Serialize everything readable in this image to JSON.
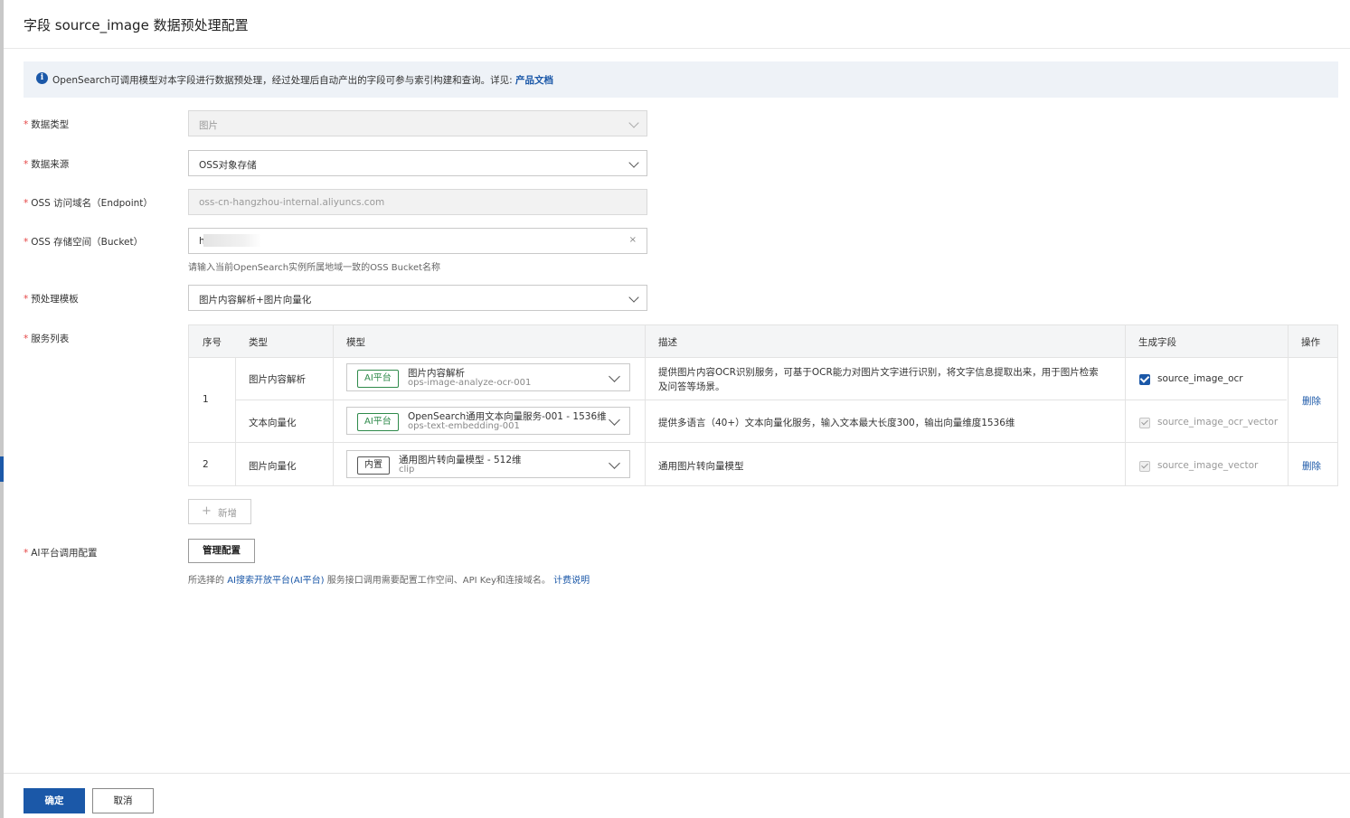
{
  "dialog": {
    "title": "字段 source_image 数据预处理配置",
    "info_text": "OpenSearch可调用模型对本字段进行数据预处理，经过处理后自动产出的字段可参与索引构建和查询。详见:",
    "info_link": "产品文档"
  },
  "form": {
    "data_type": {
      "label": "数据类型",
      "value": "图片"
    },
    "data_source": {
      "label": "数据来源",
      "value": "OSS对象存储"
    },
    "endpoint": {
      "label": "OSS 访问域名（Endpoint）",
      "value": "oss-cn-hangzhou-internal.aliyuncs.com"
    },
    "bucket": {
      "label": "OSS 存储空间（Bucket）",
      "value": "h",
      "clear": "×",
      "helper": "请输入当前OpenSearch实例所属地域一致的OSS Bucket名称"
    },
    "template": {
      "label": "预处理模板",
      "value": "图片内容解析+图片向量化"
    },
    "services_label": "服务列表",
    "ai_config": {
      "label": "AI平台调用配置",
      "button": "管理配置",
      "help_prefix": "所选择的",
      "help_link": "AI搜索开放平台(AI平台)",
      "help_middle": "服务接口调用需要配置工作空间、API Key和连接域名。",
      "help_link2": "计费说明"
    }
  },
  "service_table": {
    "headers": {
      "index": "序号",
      "type": "类型",
      "model": "模型",
      "desc": "描述",
      "field": "生成字段",
      "op": "操作"
    },
    "rows": [
      {
        "index": "1",
        "type": "图片内容解析",
        "tag": "AI平台",
        "model_name": "图片内容解析",
        "model_id": "ops-image-analyze-ocr-001",
        "desc_line1": "提供图片内容OCR识别服务，可基于OCR能力对图片文字进行识别，将文字信息提取出来，用于图片检索",
        "desc_line2": "及问答等场景。",
        "field": "source_image_ocr",
        "op": "删除"
      },
      {
        "type": "文本向量化",
        "tag": "AI平台",
        "model_name": "OpenSearch通用文本向量服务-001 - 1536维",
        "model_id": "ops-text-embedding-001",
        "desc_line1": "提供多语言（40+）文本向量化服务，输入文本最大长度300，输出向量维度1536维",
        "field": "source_image_ocr_vector"
      },
      {
        "index": "2",
        "type": "图片向量化",
        "tag": "内置",
        "model_name": "通用图片转向量模型 - 512维",
        "model_id": "clip",
        "desc_line1": "通用图片转向量模型",
        "field": "source_image_vector",
        "op": "删除"
      }
    ],
    "add_button": "新增"
  },
  "footer": {
    "confirm": "确定",
    "cancel": "取消"
  },
  "colors": {
    "primary": "#1b58a8",
    "required": "#e54545",
    "ai_tag": "#2e8a4a",
    "banner_bg": "#eef2f7"
  }
}
